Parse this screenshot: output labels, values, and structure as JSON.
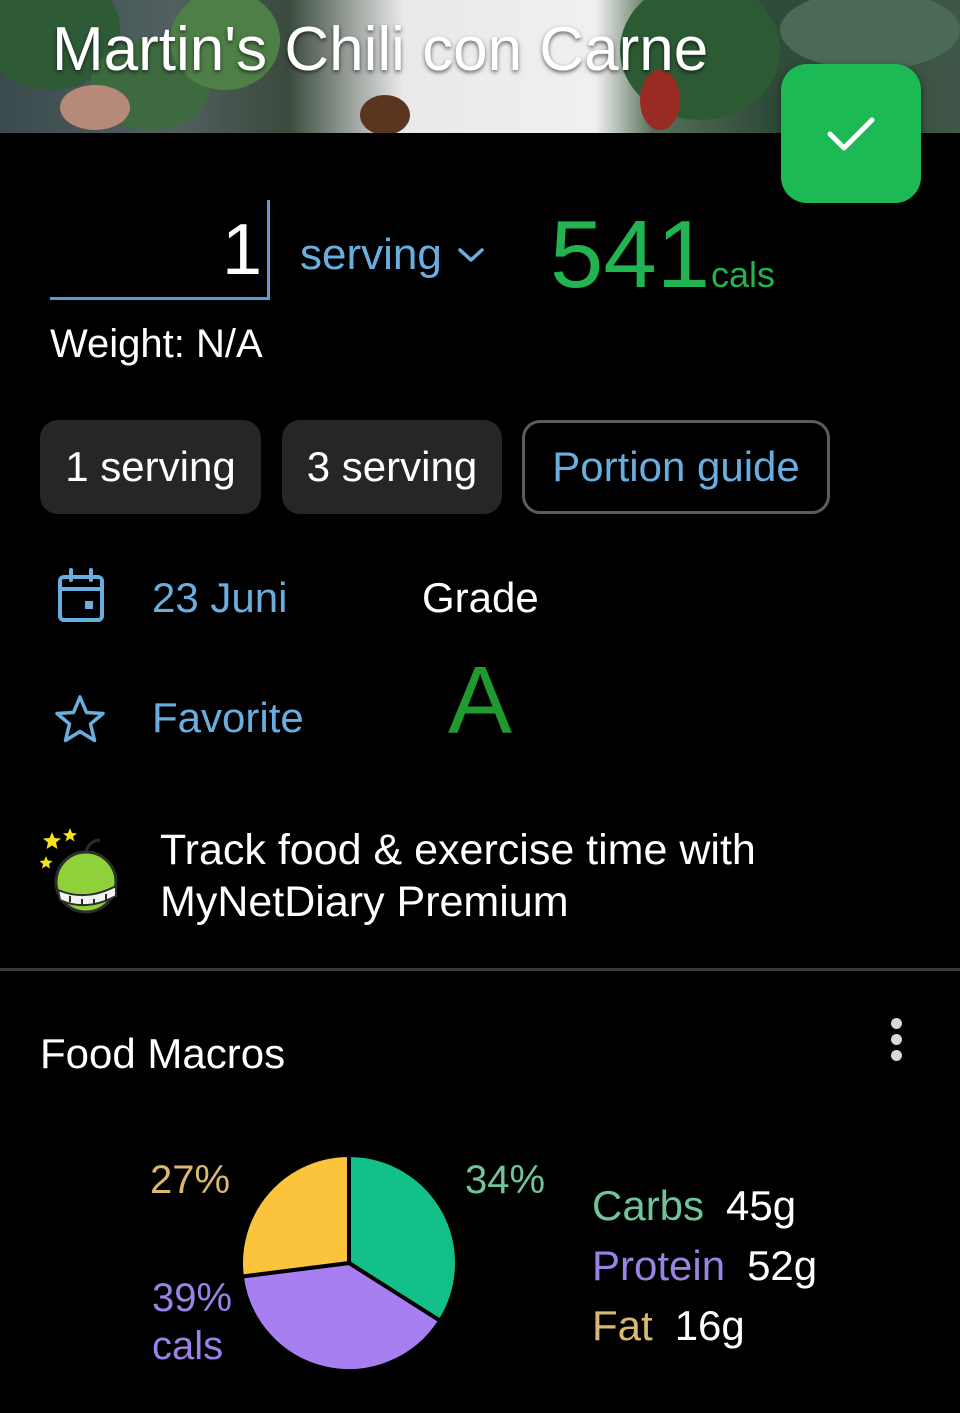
{
  "header": {
    "title": "Martin's Chili con Carne",
    "confirm_icon": "checkmark-icon"
  },
  "entry": {
    "quantity": "1",
    "unit": "serving",
    "calories": "541",
    "calories_unit": "cals",
    "weight_label": "Weight: N/A"
  },
  "quick_portions": [
    "1 serving",
    "3 serving"
  ],
  "portion_guide_label": "Portion guide",
  "details": {
    "date": "23 Juni",
    "grade_label": "Grade",
    "grade_value": "A",
    "favorite_label": "Favorite"
  },
  "promo": {
    "line1": "Track food & exercise time with",
    "line2": "MyNetDiary Premium"
  },
  "macros": {
    "title": "Food Macros",
    "carbs_label": "Carbs",
    "carbs_value": "45g",
    "protein_label": "Protein",
    "protein_value": "52g",
    "fat_label": "Fat",
    "fat_value": "16g",
    "fat_pct": "27%",
    "carbs_pct": "34%",
    "protein_pct": "39%",
    "protein_pct_unit": "cals"
  },
  "colors": {
    "accent_blue": "#6aaee0",
    "calorie_green": "#22b450",
    "confirm_green": "#1db954",
    "grade_green": "#1f9a2e",
    "carbs": "#14c08a",
    "protein": "#a87ff0",
    "fat": "#fbc43c",
    "fat_text": "#d9b870",
    "carbs_text": "#6fc59a",
    "protein_text": "#9b82e6"
  },
  "chart_data": {
    "type": "pie",
    "title": "Food Macros",
    "categories": [
      "Carbs",
      "Protein",
      "Fat"
    ],
    "values": [
      34,
      39,
      27
    ],
    "grams": [
      45,
      52,
      16
    ],
    "unit": "% cals",
    "colors": [
      "#14c08a",
      "#a87ff0",
      "#fbc43c"
    ],
    "legend_position": "right"
  }
}
